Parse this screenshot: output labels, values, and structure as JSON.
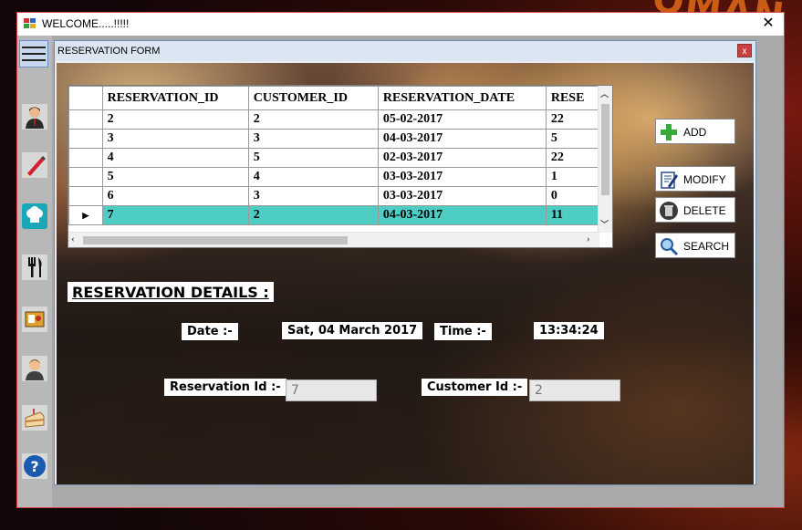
{
  "outer_window": {
    "title": "WELCOME.....!!!!!",
    "close_glyph": "✕"
  },
  "inner_window": {
    "title": "RESERVATION FORM",
    "close_glyph": "x"
  },
  "sidebar_icons": [
    "user-icon",
    "pen-icon",
    "chef-hat-icon",
    "cutlery-icon",
    "menu-card-icon",
    "customer-icon",
    "cake-icon",
    "help-icon"
  ],
  "grid": {
    "columns": [
      "RESERVATION_ID",
      "CUSTOMER_ID",
      "RESERVATION_DATE",
      "RESE"
    ],
    "rows": [
      [
        "2",
        "2",
        "05-02-2017",
        "22"
      ],
      [
        "3",
        "3",
        "04-03-2017",
        "5"
      ],
      [
        "4",
        "5",
        "02-03-2017",
        "22"
      ],
      [
        "5",
        "4",
        "03-03-2017",
        "1"
      ],
      [
        "6",
        "3",
        "03-03-2017",
        "0"
      ],
      [
        "7",
        "2",
        "04-03-2017",
        "11"
      ]
    ],
    "selected_row_marker": "▶"
  },
  "buttons": {
    "add": "ADD",
    "modify": "MODIFY",
    "delete": "DELETE",
    "search": "SEARCH"
  },
  "details": {
    "section_title": "RESERVATION DETAILS :",
    "date_label": "Date :-",
    "date_value": "Sat, 04 March 2017",
    "time_label": "Time :-",
    "time_value": "13:34:24",
    "reservation_id_label": "Reservation Id :-",
    "reservation_id_value": "7",
    "customer_id_label": "Customer Id :-",
    "customer_id_value": "2"
  },
  "colors": {
    "selected_row": "#4ecdc4",
    "outer_border": "#d84848",
    "inner_close": "#c84040"
  }
}
